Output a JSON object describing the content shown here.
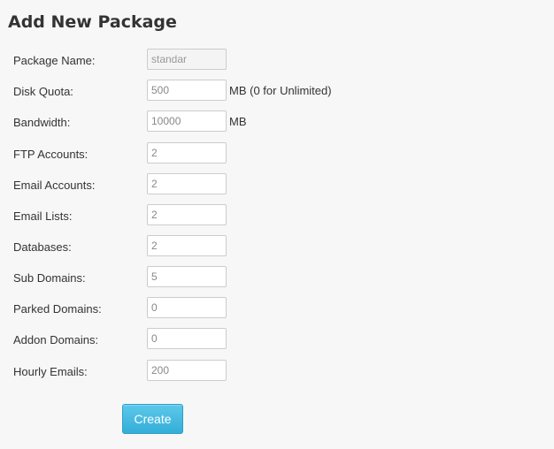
{
  "page": {
    "title": "Add New Package"
  },
  "form": {
    "fields": [
      {
        "key": "package_name",
        "label": "Package Name:",
        "value": "standar",
        "suffix": "",
        "readonly": true
      },
      {
        "key": "disk_quota",
        "label": "Disk Quota:",
        "value": "500",
        "suffix": "MB (0 for Unlimited)",
        "readonly": false
      },
      {
        "key": "bandwidth",
        "label": "Bandwidth:",
        "value": "10000",
        "suffix": "MB",
        "readonly": false
      },
      {
        "key": "ftp_accounts",
        "label": "FTP Accounts:",
        "value": "2",
        "suffix": "",
        "readonly": false
      },
      {
        "key": "email_accounts",
        "label": "Email Accounts:",
        "value": "2",
        "suffix": "",
        "readonly": false
      },
      {
        "key": "email_lists",
        "label": "Email Lists:",
        "value": "2",
        "suffix": "",
        "readonly": false
      },
      {
        "key": "databases",
        "label": "Databases:",
        "value": "2",
        "suffix": "",
        "readonly": false
      },
      {
        "key": "sub_domains",
        "label": "Sub Domains:",
        "value": "5",
        "suffix": "",
        "readonly": false
      },
      {
        "key": "parked_domains",
        "label": "Parked Domains:",
        "value": "0",
        "suffix": "",
        "readonly": false
      },
      {
        "key": "addon_domains",
        "label": "Addon Domains:",
        "value": "0",
        "suffix": "",
        "readonly": false
      },
      {
        "key": "hourly_emails",
        "label": "Hourly Emails:",
        "value": "200",
        "suffix": "",
        "readonly": false
      }
    ],
    "create_label": "Create"
  },
  "colors": {
    "background": "#f7f7f7",
    "button": "#3ab4dd",
    "button_text": "#ffffff"
  }
}
